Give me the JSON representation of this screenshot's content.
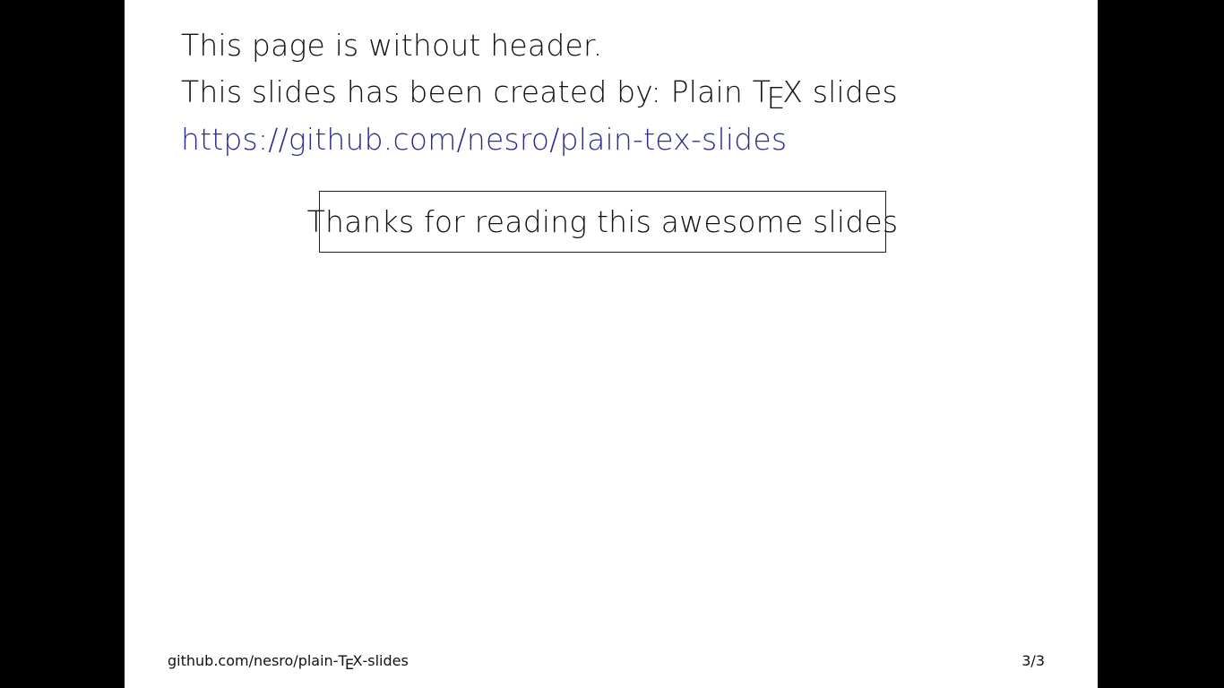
{
  "slide": {
    "line1": "This page is without header.",
    "line2_prefix": "This slides has been created by: Plain ",
    "tex_t": "T",
    "tex_e": "E",
    "tex_x": "X",
    "line2_suffix": " slides",
    "link": "https://github.com/nesro/plain-tex-slides",
    "boxed_text": "Thanks for reading this awesome slides"
  },
  "footer": {
    "left_prefix": "github.com/nesro/plain-",
    "tex_t": "T",
    "tex_e": "E",
    "tex_x": "X",
    "left_suffix": "-slides",
    "page_number": "3/3"
  },
  "colors": {
    "link": "#2d2d8f",
    "background": "#000000",
    "slide": "#ffffff"
  }
}
